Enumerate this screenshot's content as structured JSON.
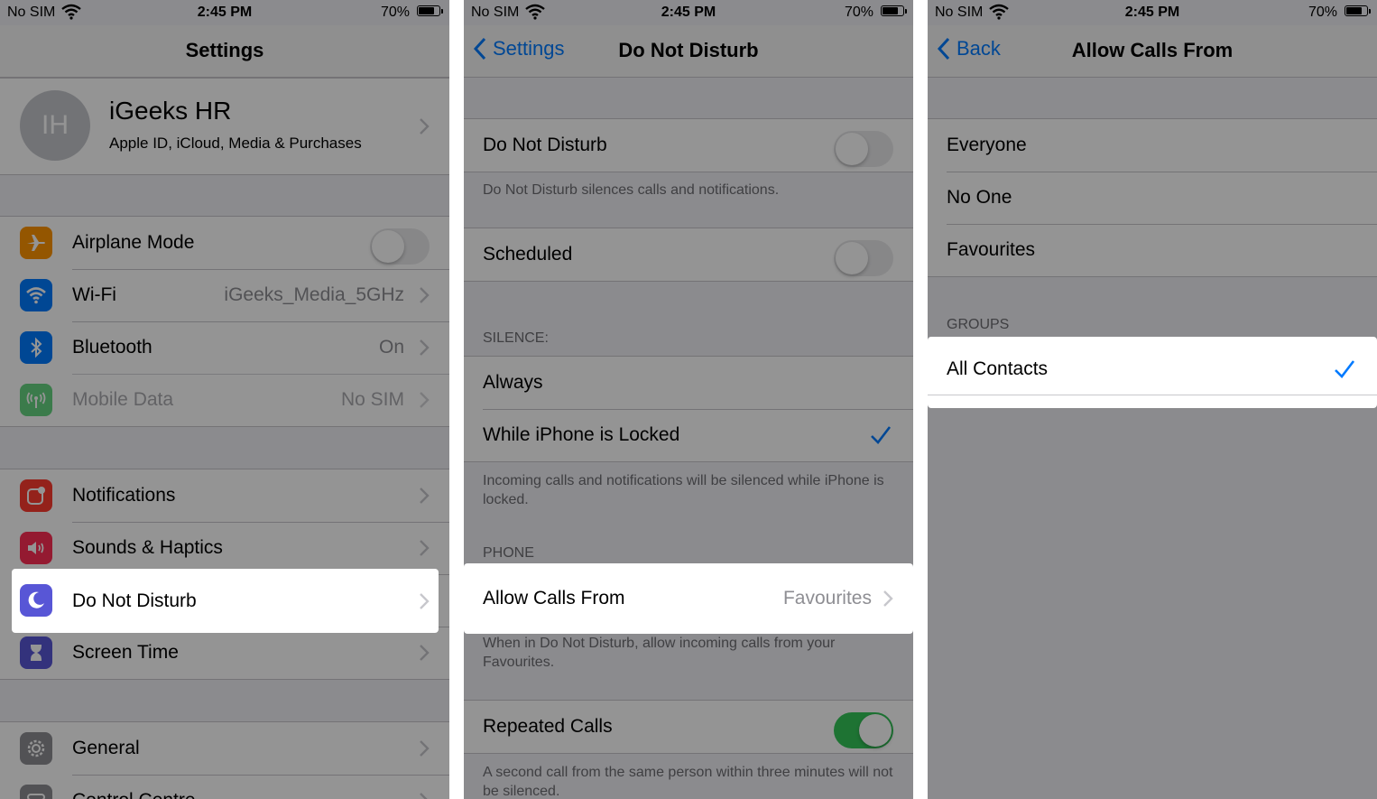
{
  "status": {
    "carrier": "No SIM",
    "time": "2:45 PM",
    "battery": "70%"
  },
  "screen1": {
    "title": "Settings",
    "profile": {
      "initials": "IH",
      "name": "iGeeks  HR",
      "subtitle": "Apple ID, iCloud, Media & Purchases"
    },
    "rows": [
      {
        "label": "Airplane Mode",
        "icon": "airplane-icon",
        "color": "#ff9500"
      },
      {
        "label": "Wi-Fi",
        "value": "iGeeks_Media_5GHz",
        "icon": "wifi-icon",
        "color": "#007aff"
      },
      {
        "label": "Bluetooth",
        "value": "On",
        "icon": "bluetooth-icon",
        "color": "#007aff"
      },
      {
        "label": "Mobile Data",
        "value": "No SIM",
        "icon": "antenna-icon",
        "color": "#34c759"
      },
      {
        "label": "Notifications",
        "icon": "notifications-icon",
        "color": "#ff3b30"
      },
      {
        "label": "Sounds & Haptics",
        "icon": "speaker-icon",
        "color": "#ff2d55"
      },
      {
        "label": "Do Not Disturb",
        "icon": "moon-icon",
        "color": "#5856d6"
      },
      {
        "label": "Screen Time",
        "icon": "hourglass-icon",
        "color": "#5856d6"
      },
      {
        "label": "General",
        "icon": "gear-icon",
        "color": "#8e8e93"
      },
      {
        "label": "Control Centre",
        "icon": "switches-icon",
        "color": "#8e8e93"
      }
    ]
  },
  "screen2": {
    "back": "Settings",
    "title": "Do Not Disturb",
    "dnd_label": "Do Not Disturb",
    "dnd_footer": "Do Not Disturb silences calls and notifications.",
    "scheduled_label": "Scheduled",
    "silence_header": "SILENCE:",
    "always_label": "Always",
    "locked_label": "While iPhone is Locked",
    "silence_footer": "Incoming calls and notifications will be silenced while iPhone is locked.",
    "phone_header": "PHONE",
    "allow_label": "Allow Calls From",
    "allow_value": "Favourites",
    "allow_footer": "When in Do Not Disturb, allow incoming calls from your Favourites.",
    "repeated_label": "Repeated Calls",
    "repeated_footer": "A second call from the same person within three minutes will not be silenced."
  },
  "screen3": {
    "back": "Back",
    "title": "Allow Calls From",
    "options": [
      "Everyone",
      "No One",
      "Favourites"
    ],
    "groups_header": "GROUPS",
    "group_option": "All Contacts"
  },
  "colors": {
    "accent": "#007aff",
    "toggle_on": "#34c759"
  }
}
